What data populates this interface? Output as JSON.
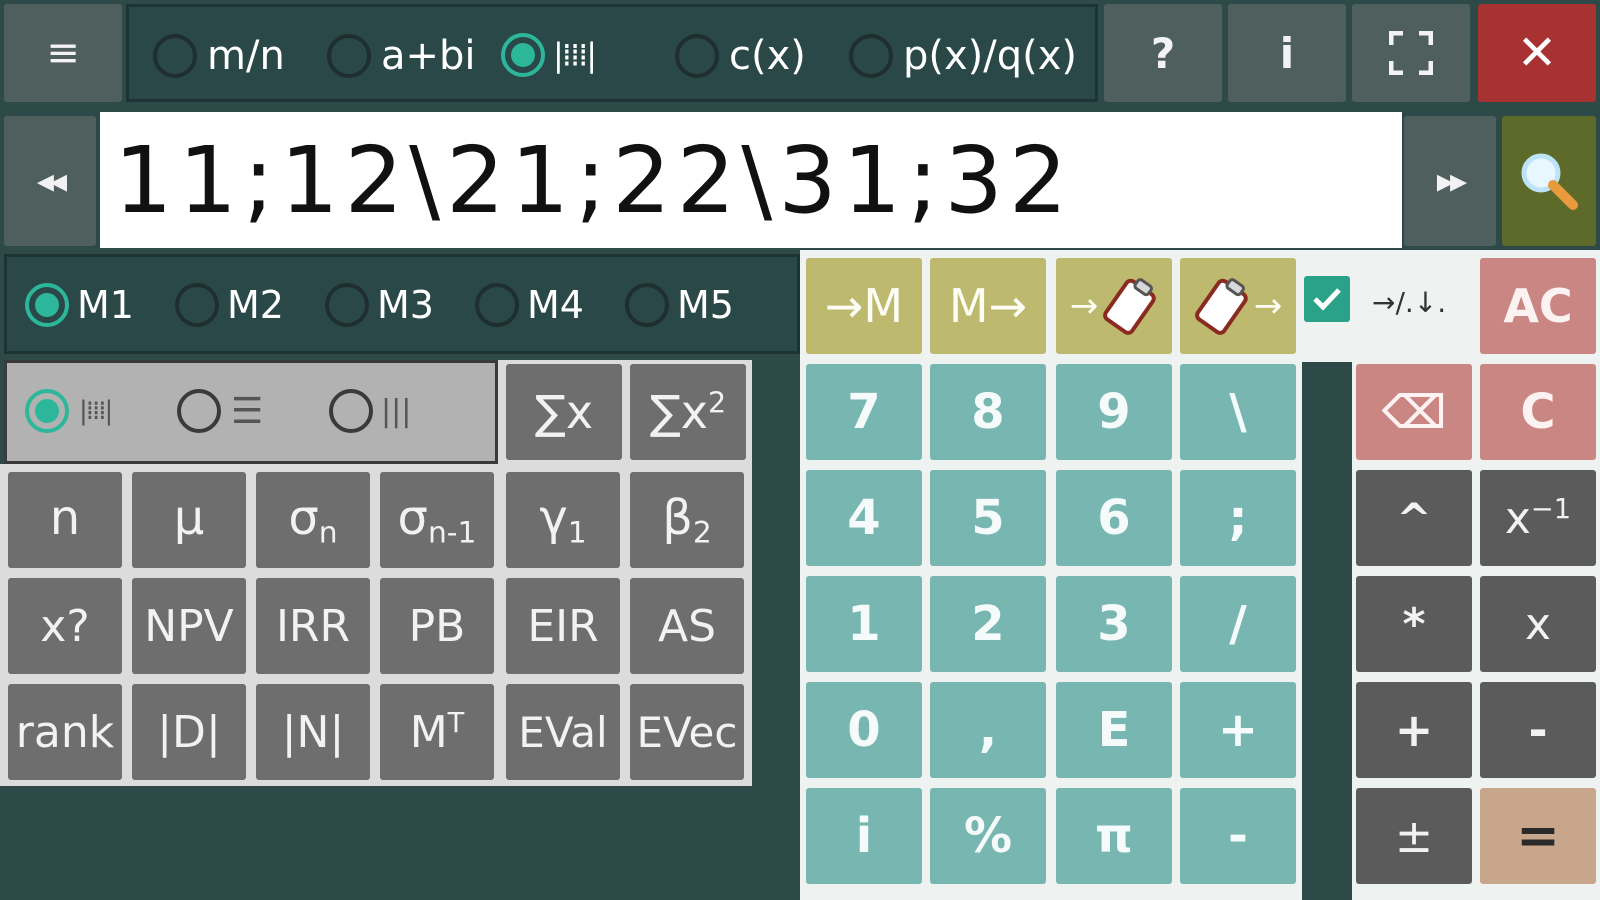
{
  "topbar": {
    "menu_icon": "≡",
    "modes": [
      {
        "label": "m/n",
        "selected": false
      },
      {
        "label": "a+bi",
        "selected": false
      },
      {
        "label": "|⁞⁞⁞|",
        "selected": true
      },
      {
        "label": "c(x)",
        "selected": false
      },
      {
        "label": "p(x)/q(x)",
        "selected": false
      }
    ],
    "help_label": "?",
    "info_label": "i",
    "close_label": "✕"
  },
  "input": {
    "value": "11;12\\21;22\\31;32",
    "left_arrows": "◂◂",
    "right_arrows": "▸▸"
  },
  "memory": {
    "slots": [
      {
        "label": "M1",
        "selected": true
      },
      {
        "label": "M2",
        "selected": false
      },
      {
        "label": "M3",
        "selected": false
      },
      {
        "label": "M4",
        "selected": false
      },
      {
        "label": "M5",
        "selected": false
      }
    ],
    "to_m": "→M",
    "m_to": "M→",
    "arrow": "→",
    "checkbox_checked": true,
    "sep_label": "→/.↓.",
    "ac": "AC"
  },
  "view_modes": [
    {
      "label": "|⁞⁞⁞|",
      "selected": true
    },
    {
      "label": "☰",
      "selected": false
    },
    {
      "label": "|||",
      "selected": false
    }
  ],
  "func": {
    "sum_x": "∑x",
    "sum_x2_base": "∑x",
    "sum_x2_sup": "2",
    "row1": [
      {
        "base": "n",
        "sub": ""
      },
      {
        "base": "μ",
        "sub": ""
      },
      {
        "base": "σ",
        "sub": "n"
      },
      {
        "base": "σ",
        "sub": "n-1"
      },
      {
        "base": "γ",
        "sub": "1"
      },
      {
        "base": "β",
        "sub": "2"
      }
    ],
    "row2": [
      "x?",
      "NPV",
      "IRR",
      "PB",
      "EIR",
      "AS"
    ],
    "row3a": [
      "rank",
      "|D|",
      "|N|"
    ],
    "mt_base": "M",
    "mt_sup": "T",
    "row3b": [
      "EVal",
      "EVec"
    ]
  },
  "numpad": [
    [
      "7",
      "8",
      "9",
      "\\"
    ],
    [
      "4",
      "5",
      "6",
      ";"
    ],
    [
      "1",
      "2",
      "3",
      "/"
    ],
    [
      "0",
      ",",
      "E",
      "+"
    ],
    [
      "i",
      "%",
      "π",
      "-"
    ]
  ],
  "ops": {
    "backspace": "⌫",
    "c": "C",
    "caret": "^",
    "inv_base": "x",
    "inv_sup": "−1",
    "mul": "*",
    "x": "x",
    "plus": "+",
    "minus": "-",
    "pm": "±",
    "eq": "="
  },
  "colors": {
    "accent": "#2db79a",
    "teal_key": "#78b6b2",
    "olive_key": "#bdb96f",
    "pink_key": "#c98683",
    "close": "#a83232",
    "search": "#5d6a2a"
  }
}
